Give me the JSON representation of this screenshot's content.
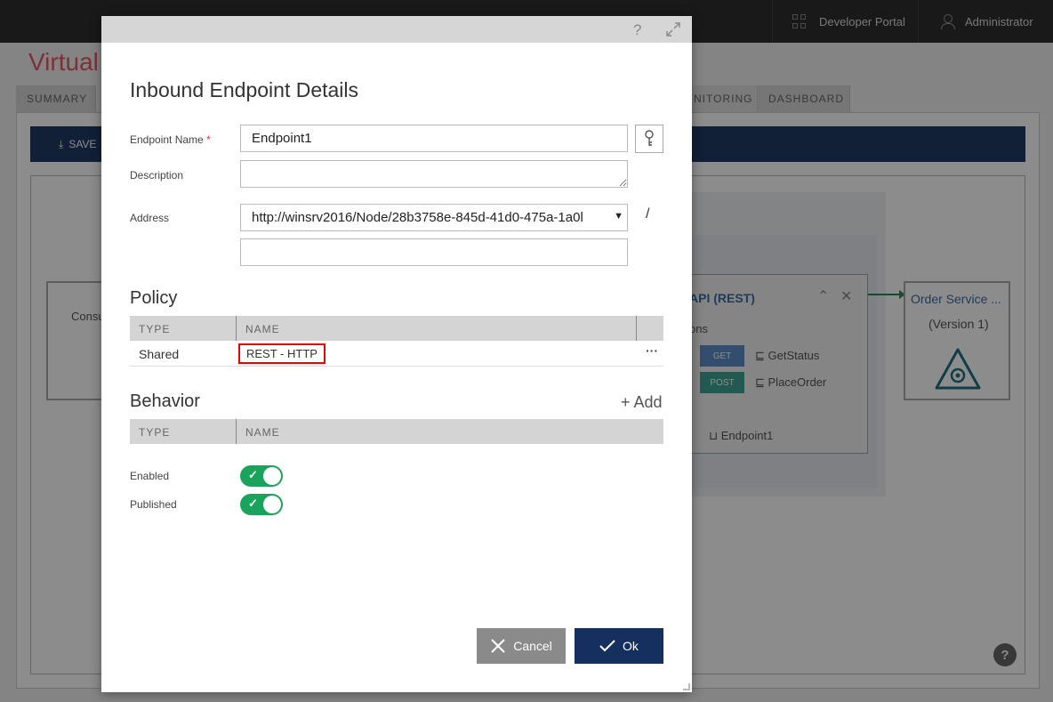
{
  "app": {
    "topbar": {
      "portal_label": "Developer Portal",
      "admin_label": "Administrator"
    },
    "page_title": "Virtual",
    "tabs": {
      "summary": "SUMMARY",
      "monitoring": "NITORING",
      "dashboard": "DASHBOARD"
    },
    "toolbar": {
      "save_label": "SAVE"
    },
    "canvas": {
      "consumer_label": "Consu",
      "api_title": "API (REST)",
      "operations_label": "ons",
      "operations": [
        {
          "verb": "GET",
          "name": "GetStatus"
        },
        {
          "verb": "POST",
          "name": "PlaceOrder"
        }
      ],
      "endpoint_name": "Endpoint1",
      "service_name": "Order Service ...",
      "service_version": "(Version 1)"
    }
  },
  "modal": {
    "title": "Inbound Endpoint Details",
    "fields": {
      "endpoint_name_label": "Endpoint Name",
      "required_mark": "*",
      "endpoint_name_value": "Endpoint1",
      "description_label": "Description",
      "description_value": "",
      "address_label": "Address",
      "address_value": "http://winsrv2016/Node/28b3758e-845d-41d0-475a-1a0l",
      "address_separator": "/",
      "address_suffix_value": ""
    },
    "policy": {
      "heading": "Policy",
      "columns": [
        "TYPE",
        "NAME"
      ],
      "rows": [
        {
          "type": "Shared",
          "name": "REST - HTTP",
          "more": "···"
        }
      ]
    },
    "behavior": {
      "heading": "Behavior",
      "add_label": "+ Add",
      "columns": [
        "TYPE",
        "NAME"
      ]
    },
    "toggles": {
      "enabled_label": "Enabled",
      "enabled": true,
      "published_label": "Published",
      "published": true
    },
    "buttons": {
      "cancel": "Cancel",
      "ok": "Ok"
    }
  },
  "colors": {
    "accent": "#15305e",
    "toggle_on": "#1aa35a",
    "highlight": "#ee0000"
  }
}
